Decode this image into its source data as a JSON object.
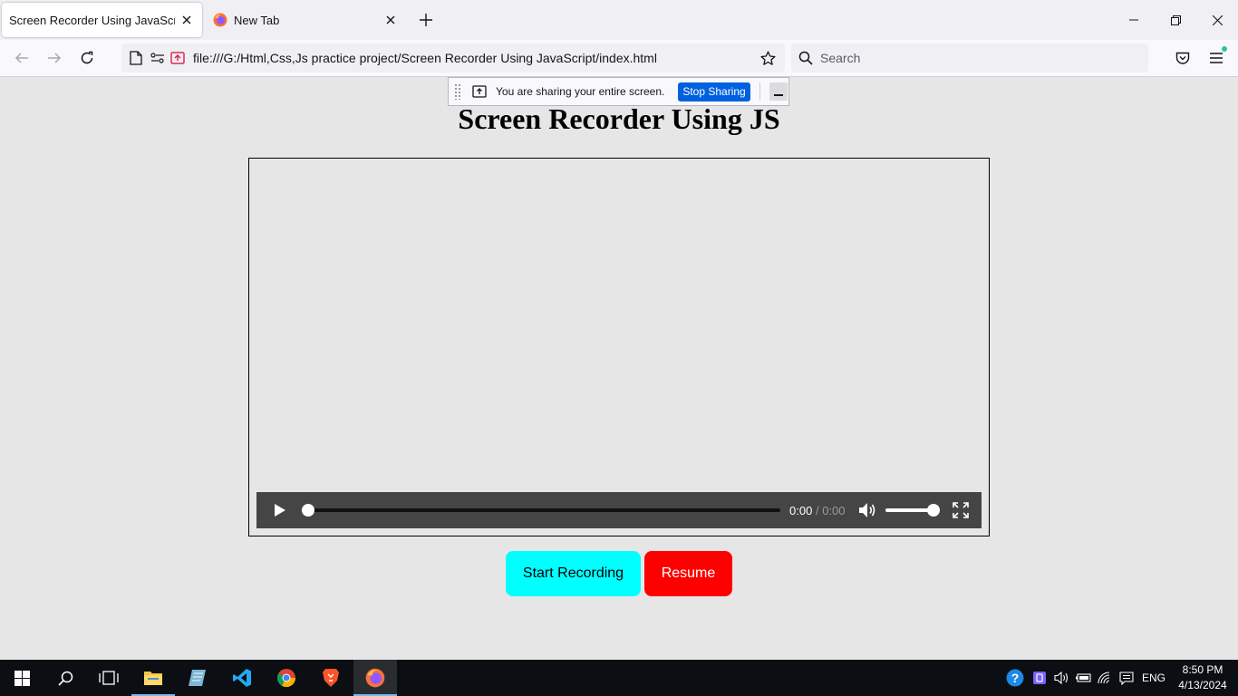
{
  "browser": {
    "tabs": [
      {
        "title": "Screen Recorder Using JavaScript",
        "active": true
      },
      {
        "title": "New Tab",
        "active": false
      }
    ],
    "url": "file:///G:/Html,Css,Js practice project/Screen Recorder Using JavaScript/index.html",
    "search_placeholder": "Search"
  },
  "sharing": {
    "message": "You are sharing your entire screen.",
    "stop_label": "Stop Sharing"
  },
  "page": {
    "title": "Screen Recorder Using JS",
    "player": {
      "current_time": "0:00",
      "separator": "/",
      "duration": "0:00",
      "progress_fraction": 0,
      "volume_fraction": 1
    },
    "buttons": {
      "start_label": "Start Recording",
      "resume_label": "Resume",
      "start_color": "#00ffff",
      "resume_color": "#ff0000"
    }
  },
  "taskbar": {
    "apps": [
      "start-icon",
      "search-icon",
      "task-view-icon",
      "file-explorer-icon",
      "notepad-icon",
      "vscode-icon",
      "chrome-icon",
      "brave-icon",
      "firefox-icon"
    ],
    "language": "ENG",
    "time": "8:50 PM",
    "date": "4/13/2024"
  },
  "colors": {
    "accent": "#0061e0",
    "page_background": "#e6e6e6",
    "player_bar": "#454545"
  }
}
